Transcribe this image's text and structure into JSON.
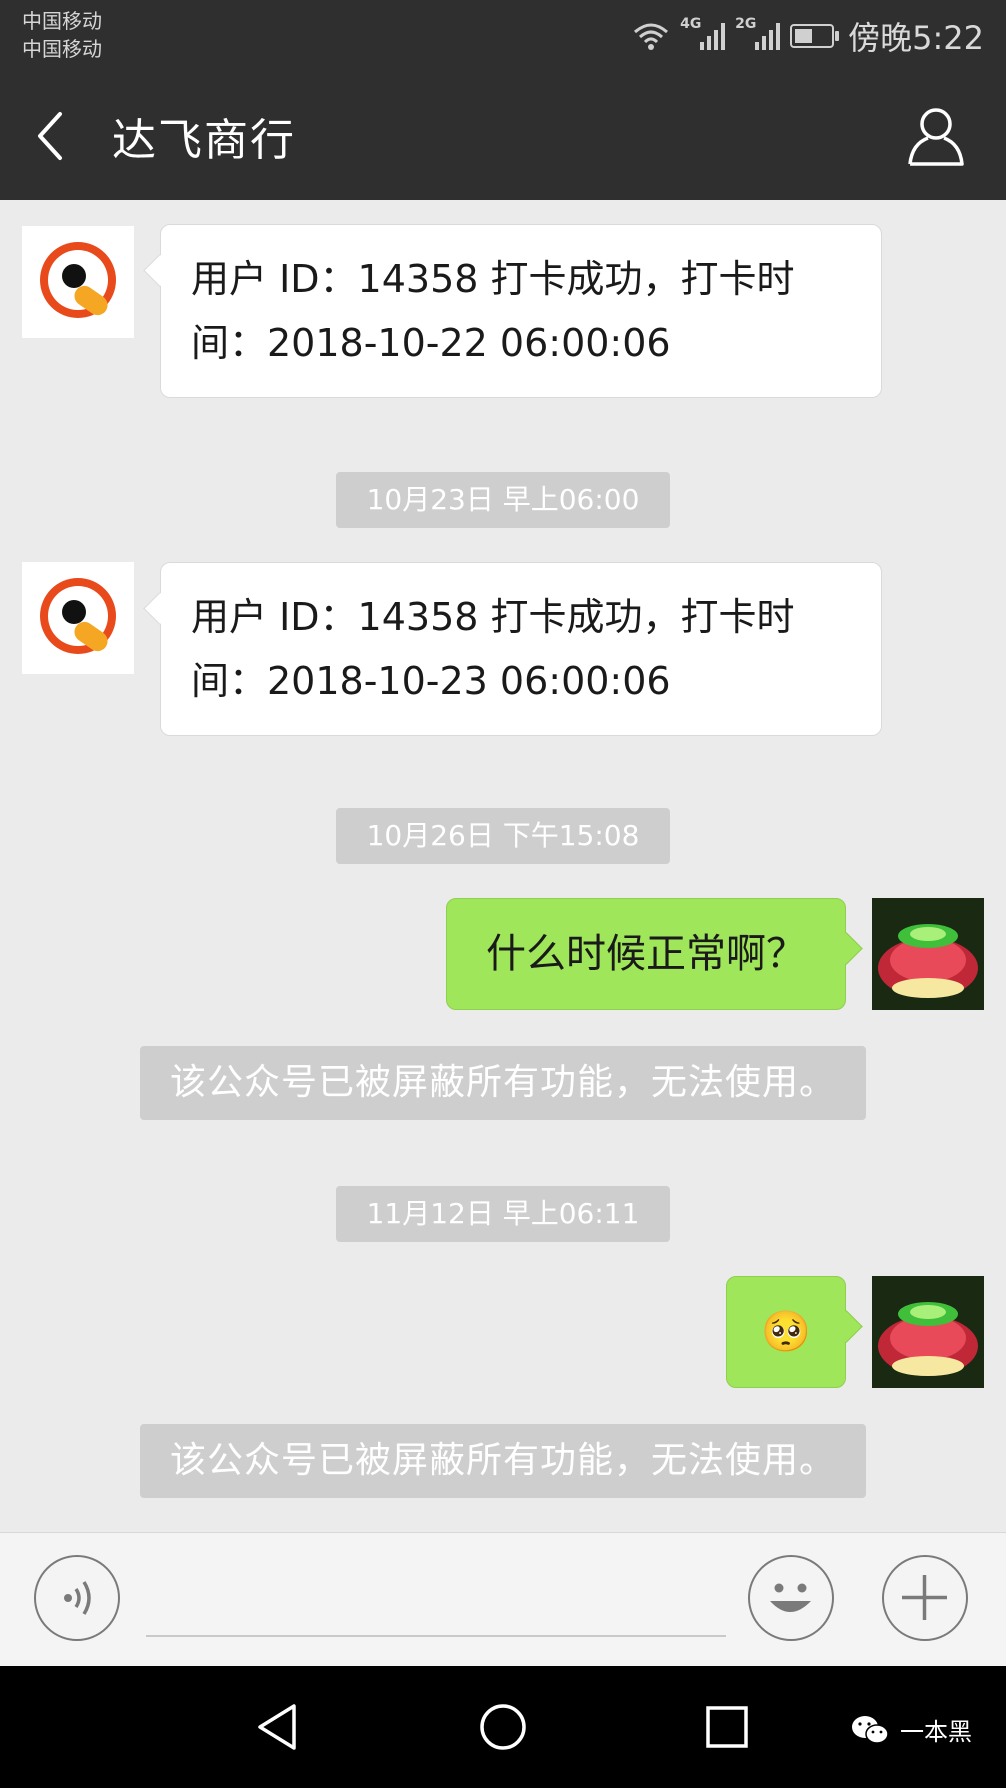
{
  "status_bar": {
    "carrier_1": "中国移动",
    "carrier_2": "中国移动",
    "network_1": "4G",
    "network_2": "2G",
    "time": "傍晚5:22",
    "battery_level": 0.5
  },
  "header": {
    "title": "达飞商行",
    "back_icon": "chevron-left-icon",
    "profile_icon": "person-icon"
  },
  "messages": [
    {
      "type": "incoming",
      "line1": "用户 ID：14358 打卡成功，打卡时",
      "line2": "间：2018-10-22 06:00:06"
    },
    {
      "type": "timestamp",
      "text": "10月23日 早上06:00"
    },
    {
      "type": "incoming",
      "line1": "用户 ID：14358 打卡成功，打卡时",
      "line2": "间：2018-10-23 06:00:06"
    },
    {
      "type": "timestamp",
      "text": "10月26日 下午15:08"
    },
    {
      "type": "outgoing",
      "text": "什么时候正常啊？"
    },
    {
      "type": "system",
      "text": "该公众号已被屏蔽所有功能，无法使用。"
    },
    {
      "type": "timestamp",
      "text": "11月12日 早上06:11"
    },
    {
      "type": "outgoing_emoji",
      "emoji": "🥺"
    },
    {
      "type": "system",
      "text": "该公众号已被屏蔽所有功能，无法使用。"
    }
  ],
  "input_bar": {
    "voice_icon": "voice-icon",
    "emoji_icon": "smiley-icon",
    "plus_icon": "plus-icon"
  },
  "nav_bar": {
    "back_icon": "triangle-back-icon",
    "home_icon": "circle-home-icon",
    "recents_icon": "square-recents-icon"
  },
  "watermark": {
    "text": "一本黑"
  },
  "colors": {
    "header_bg": "#2f2f2f",
    "chat_bg": "#ebebeb",
    "outgoing_bubble": "#9fe65a",
    "timestamp_chip": "#cecece"
  }
}
